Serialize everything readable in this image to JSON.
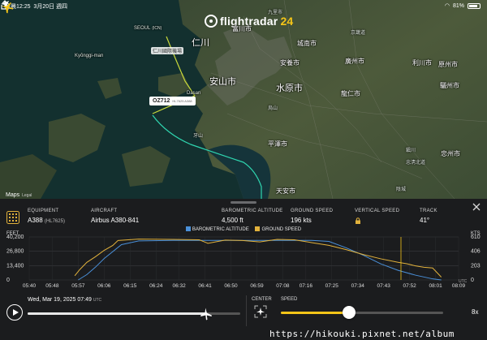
{
  "status_bar": {
    "time": "凌晨12:25",
    "date": "3月20日 週四",
    "battery": "81%",
    "battery_level": 0.81
  },
  "app": {
    "logo_text": "flightradar",
    "logo_accent": "24"
  },
  "map": {
    "places": [
      {
        "name": "SEOUL",
        "sub": "(ICN)",
        "cls": "sm"
      },
      {
        "name": "仁川",
        "cls": "big"
      },
      {
        "name": "富川市",
        "cls": ""
      },
      {
        "name": "九里市",
        "cls": "sm"
      },
      {
        "name": "城南市",
        "cls": ""
      },
      {
        "name": "京畿道",
        "cls": "sm"
      },
      {
        "name": "安養市",
        "cls": ""
      },
      {
        "name": "廣州市",
        "cls": ""
      },
      {
        "name": "利川市",
        "cls": ""
      },
      {
        "name": "原州市",
        "cls": ""
      },
      {
        "name": "安山市",
        "cls": "big"
      },
      {
        "name": "水原市",
        "cls": "big"
      },
      {
        "name": "龍仁市",
        "cls": ""
      },
      {
        "name": "驪州市",
        "cls": ""
      },
      {
        "name": "烏山",
        "cls": "sm"
      },
      {
        "name": "平澤市",
        "cls": ""
      },
      {
        "name": "忠州市",
        "cls": ""
      },
      {
        "name": "天安市",
        "cls": ""
      },
      {
        "name": "牙山",
        "cls": "sm"
      },
      {
        "name": "鎭川",
        "cls": "sm"
      },
      {
        "name": "忠淸北道",
        "cls": "sm"
      },
      {
        "name": "陰城",
        "cls": "sm"
      },
      {
        "name": "Kyŏnggi-man",
        "cls": "sm"
      },
      {
        "name": "Dasan",
        "cls": "sm"
      },
      {
        "name": "仁川國際機場",
        "cls": "white-bg"
      }
    ],
    "flight_tag": {
      "callsign": "OZ712",
      "sub": "HL7625 A388"
    },
    "attribution": {
      "brand": "Maps",
      "legal": "Legal"
    }
  },
  "details": {
    "equipment": {
      "label": "EQUIPMENT",
      "value": "A388",
      "sub": "(HL7625)"
    },
    "aircraft": {
      "label": "AIRCRAFT",
      "value": "Airbus A380-841"
    },
    "altitude": {
      "label": "BAROMETRIC ALTITUDE",
      "value": "4,500 ft"
    },
    "ground_speed": {
      "label": "GROUND SPEED",
      "value": "196 kts"
    },
    "vertical_speed": {
      "label": "VERTICAL SPEED"
    },
    "track": {
      "label": "TRACK",
      "value": "41°"
    }
  },
  "chart_data": {
    "type": "line",
    "y_left_unit": "FEET",
    "y_right_unit": "KTS",
    "x_unit": "UTC",
    "y_left_ticks": [
      "40,200",
      "26,800",
      "13,400",
      "0"
    ],
    "y_right_ticks": [
      "610",
      "406",
      "203",
      "0"
    ],
    "x_ticks": [
      "05:40",
      "05:48",
      "05:57",
      "06:06",
      "06:15",
      "06:24",
      "06:32",
      "06:41",
      "06:50",
      "06:59",
      "07:08",
      "07:16",
      "07:25",
      "07:34",
      "07:43",
      "07:52",
      "08:01",
      "08:09"
    ],
    "ylim_left": [
      0,
      40200
    ],
    "ylim_right": [
      0,
      610
    ],
    "legend": [
      {
        "name": "BAROMETRIC ALTITUDE",
        "color": "#4a90d9"
      },
      {
        "name": "GROUND SPEED",
        "color": "#e2b23c"
      }
    ],
    "series": [
      {
        "name": "BAROMETRIC ALTITUDE",
        "x": [
          5.95,
          6.0,
          6.05,
          6.1,
          6.2,
          6.3,
          6.5,
          6.9,
          7.0,
          7.2,
          7.3,
          7.4,
          7.5,
          7.6,
          7.7,
          7.8,
          7.9,
          8.0,
          8.05
        ],
        "values": [
          0,
          5000,
          12000,
          20000,
          33000,
          36500,
          37000,
          37000,
          37000,
          37000,
          37000,
          36000,
          30000,
          23000,
          15000,
          9000,
          4500,
          1000,
          0
        ]
      },
      {
        "name": "GROUND SPEED",
        "x": [
          5.93,
          5.96,
          6.0,
          6.05,
          6.1,
          6.15,
          6.18,
          6.3,
          6.5,
          6.65,
          6.7,
          6.8,
          6.9,
          7.0,
          7.1,
          7.2,
          7.3,
          7.4,
          7.5,
          7.6,
          7.7,
          7.8,
          7.85,
          7.9,
          7.95,
          8.0,
          8.05
        ],
        "values": [
          60,
          150,
          250,
          330,
          420,
          490,
          560,
          580,
          575,
          570,
          520,
          565,
          560,
          540,
          575,
          570,
          530,
          490,
          430,
          360,
          300,
          250,
          230,
          200,
          180,
          170,
          40
        ]
      }
    ]
  },
  "playback": {
    "datetime": "Wed, Mar 19, 2025",
    "time": "07:49",
    "tz": "UTC",
    "progress": 0.84,
    "center_label": "CENTER",
    "speed_label": "SPEED",
    "speed_value": "8x",
    "speed_progress": 0.42
  },
  "watermark": "https://hikouki.pixnet.net/album"
}
